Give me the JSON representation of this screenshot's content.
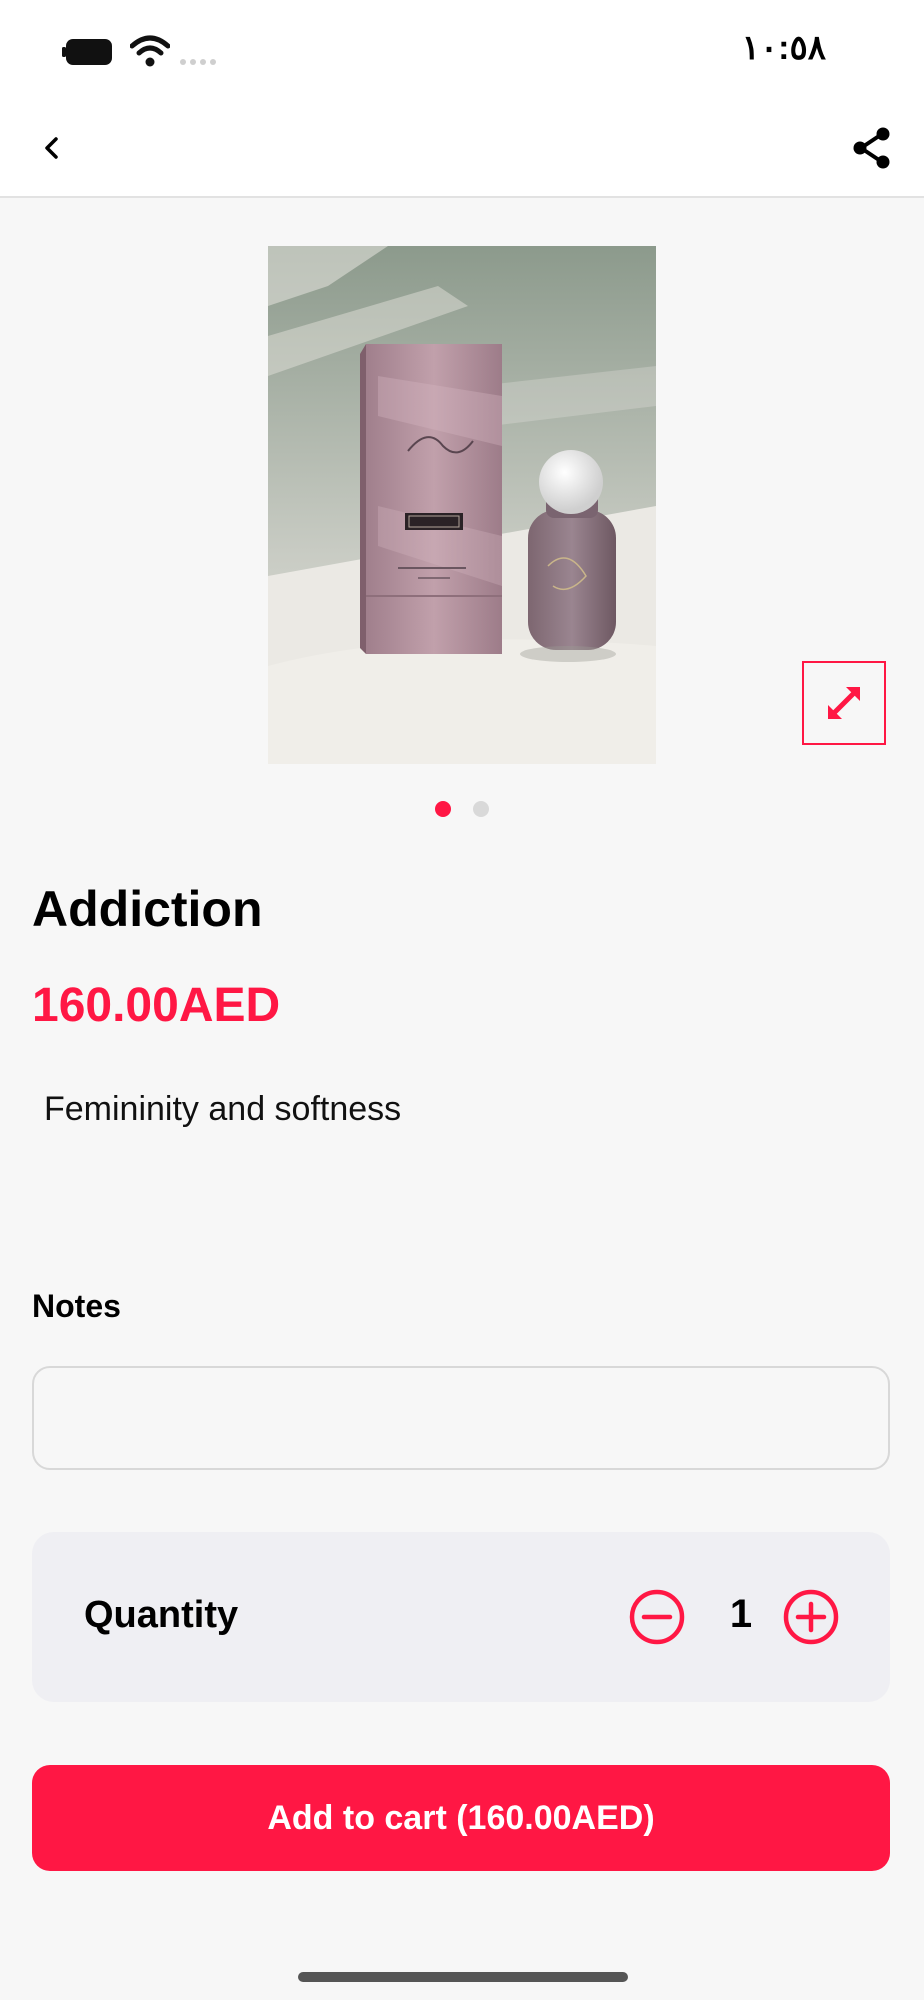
{
  "status_bar": {
    "time": "١٠:٥٨"
  },
  "nav": {
    "back_icon": "chevron-left-icon",
    "share_icon": "share-icon"
  },
  "product": {
    "image_alt": "Addiction",
    "title": "Addiction",
    "price": "160.00AED",
    "description": "Femininity and softness",
    "carousel": {
      "count": 2,
      "active_index": 0
    }
  },
  "notes": {
    "label": "Notes",
    "value": ""
  },
  "quantity": {
    "label": "Quantity",
    "value": "1"
  },
  "cta": {
    "label": "Add to cart (160.00AED)"
  },
  "colors": {
    "accent": "#ff1744",
    "background": "#f7f7f7",
    "panel": "#efeff3"
  }
}
